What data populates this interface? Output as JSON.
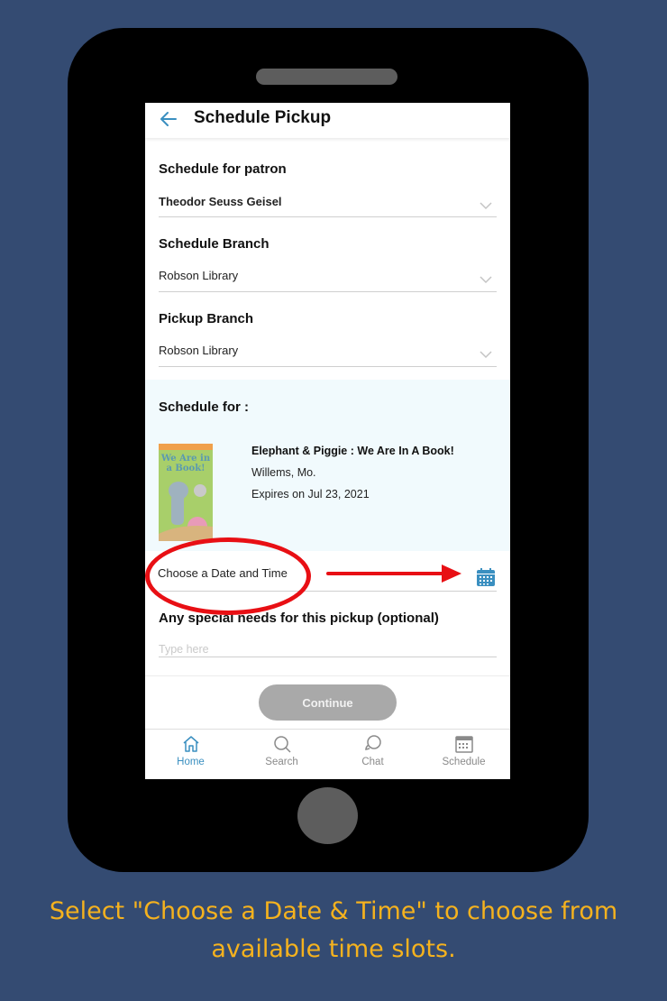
{
  "header": {
    "title": "Schedule Pickup",
    "back_icon": "arrow-left-icon"
  },
  "form": {
    "patron": {
      "label": "Schedule for patron",
      "value": "Theodor Seuss Geisel"
    },
    "schedule_branch": {
      "label": "Schedule Branch",
      "value": "Robson Library"
    },
    "pickup_branch": {
      "label": "Pickup Branch",
      "value": "Robson Library"
    },
    "schedule_for": {
      "label": "Schedule for :",
      "item": {
        "title": "Elephant & Piggie : We Are In A Book!",
        "author": "Willems, Mo.",
        "expiry": "Expires on Jul 23, 2021",
        "cover_text": "We Are in a Book!"
      }
    },
    "date_time": {
      "value": "Choose a Date and Time",
      "icon": "calendar-icon"
    },
    "special_needs": {
      "label": "Any special needs for this pickup (optional)",
      "placeholder": "Type here",
      "value": ""
    }
  },
  "actions": {
    "continue_label": "Continue"
  },
  "tabbar": {
    "active": "Home",
    "items": [
      {
        "label": "Home",
        "icon": "home-icon"
      },
      {
        "label": "Search",
        "icon": "search-icon"
      },
      {
        "label": "Chat",
        "icon": "chat-icon"
      },
      {
        "label": "Schedule",
        "icon": "calendar-icon"
      }
    ]
  },
  "colors": {
    "accent": "#3a8fc0",
    "annotation": "#e80f14",
    "caption": "#f5b21e",
    "background": "#344b72"
  },
  "caption": "Select \"Choose a Date & Time\" to choose from available time slots."
}
